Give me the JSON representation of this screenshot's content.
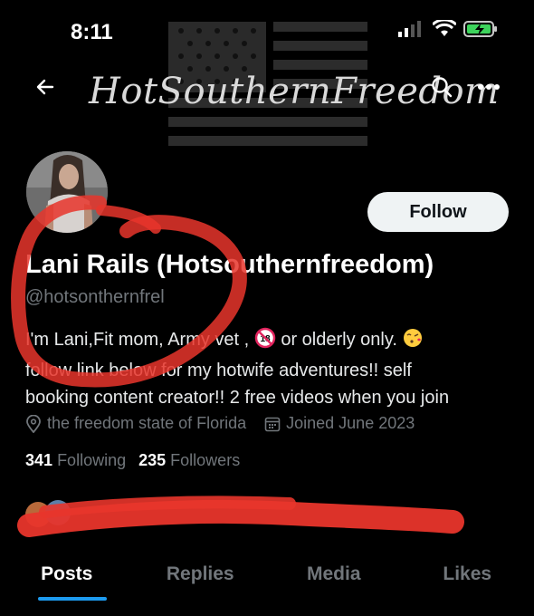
{
  "status_bar": {
    "time": "8:11"
  },
  "header": {
    "title": "HotSouthernFreedom",
    "back_icon": "arrow-left-icon",
    "search_icon": "search-icon",
    "more_icon": "more-horizontal-icon"
  },
  "profile": {
    "follow_label": "Follow",
    "display_name": "Lani Rails (Hotsouthernfreedom)",
    "handle": "@hotsonthernfrel",
    "bio_lines": [
      "I'm Lani,Fit mom, Army vet ,",
      "or olderly only.",
      "follow link below for my hotwife adventures!! self",
      "booking content creator!! 2 free videos when you join"
    ],
    "location": "the freedom state of Florida",
    "joined": "Joined June 2023",
    "following_count": "341",
    "following_label": "Following",
    "followers_count": "235",
    "followers_label": "Followers"
  },
  "tabs": [
    {
      "label": "Posts",
      "active": true
    },
    {
      "label": "Replies",
      "active": false
    },
    {
      "label": "Media",
      "active": false
    },
    {
      "label": "Likes",
      "active": false
    }
  ],
  "colors": {
    "background": "#000000",
    "accent": "#1d9bf0",
    "secondary_text": "#71767b",
    "annotation_red": "#e8352b"
  }
}
